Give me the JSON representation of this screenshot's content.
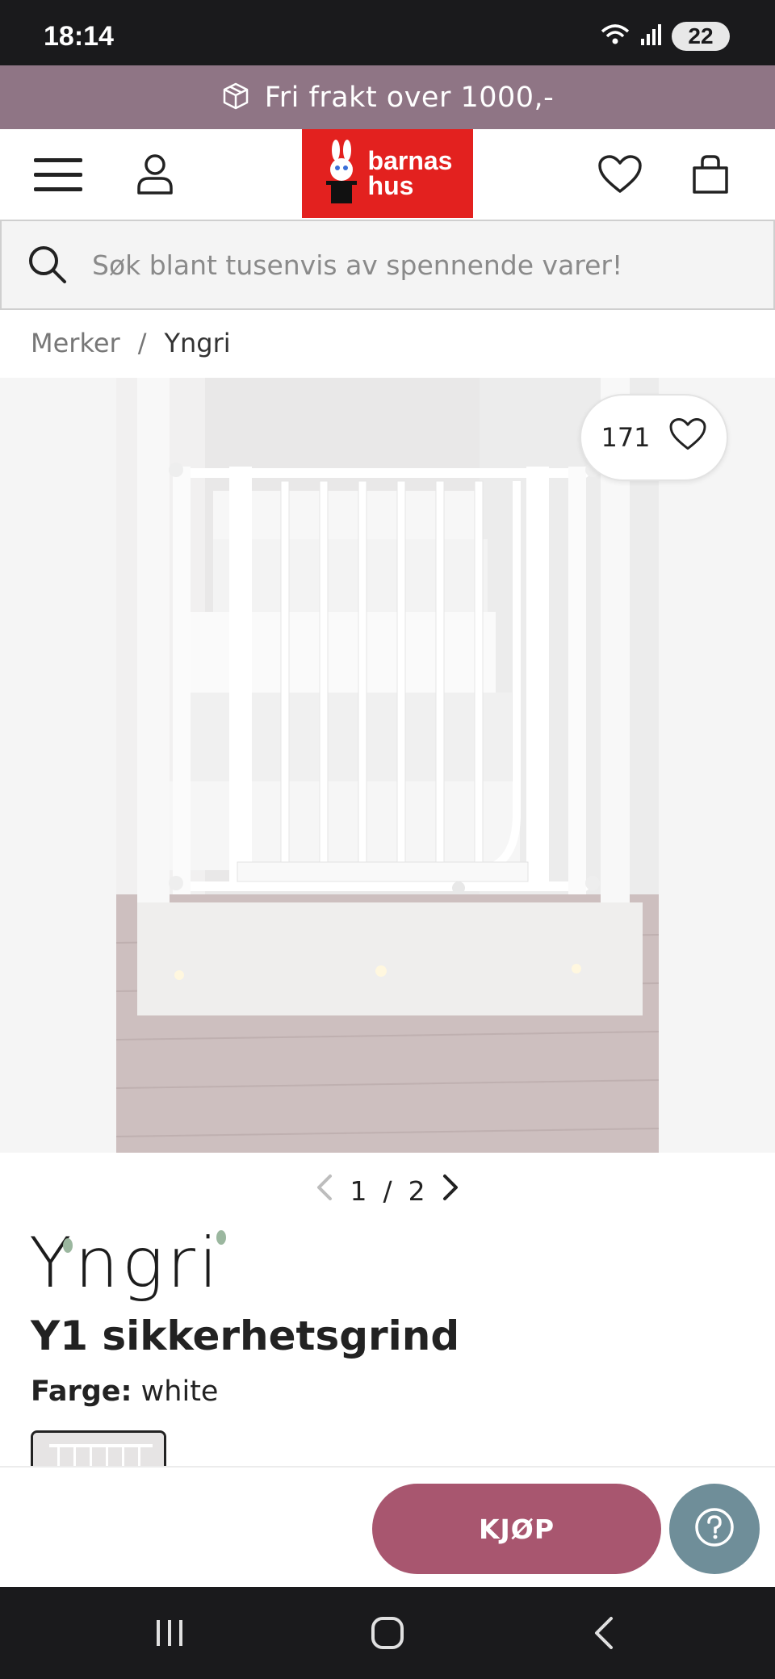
{
  "status_bar": {
    "time": "18:14",
    "battery": "22"
  },
  "promo": {
    "text": "Fri frakt over 1000,-",
    "icon": "package-icon"
  },
  "header": {
    "menu_icon": "hamburger-menu-icon",
    "account_icon": "user-icon",
    "logo_text": "barnas hus",
    "logo_line1": "barnas",
    "logo_line2": "hus",
    "wishlist_icon": "heart-icon",
    "cart_icon": "shopping-bag-icon"
  },
  "search": {
    "placeholder": "Søk blant tusenvis av spennende varer!"
  },
  "breadcrumb": {
    "items": [
      "Merker",
      "Yngri"
    ],
    "separator": "/"
  },
  "gallery": {
    "favorites_count": "171",
    "pager": {
      "current": "1",
      "separator": "/",
      "total": "2"
    }
  },
  "product": {
    "brand": "Yngri",
    "brand_logo_text": "Yngri",
    "title": "Y1 sikkerhetsgrind",
    "color_label": "Farge:",
    "color_value": "white"
  },
  "actions": {
    "buy_label": "KJØP",
    "help_icon": "question-mark-icon"
  },
  "colors": {
    "promo_bg": "#8f7585",
    "logo_bg": "#e3211f",
    "buy_bg": "#a8566f",
    "help_bg": "#6f8e99",
    "system_bar_bg": "#1a1a1c"
  }
}
